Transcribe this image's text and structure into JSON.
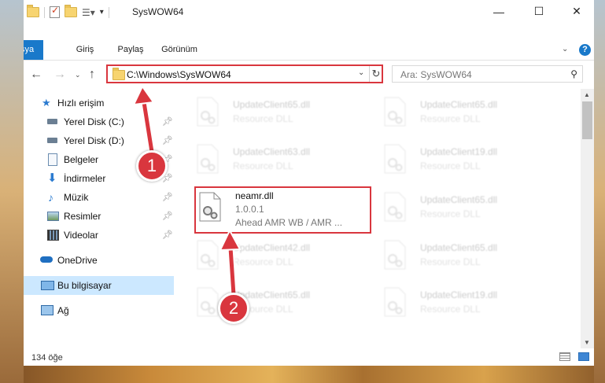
{
  "window": {
    "title": "SysWOW64",
    "minimize_glyph": "—",
    "maximize_glyph": "☐",
    "close_glyph": "✕"
  },
  "ribbon": {
    "tabs": [
      "Dosya",
      "Giriş",
      "Paylaş",
      "Görünüm"
    ],
    "help_glyph": "?"
  },
  "address": {
    "path": "C:\\Windows\\SysWOW64"
  },
  "search": {
    "placeholder": "Ara: SysWOW64"
  },
  "sidebar": {
    "items": [
      {
        "label": "Hızlı erişim",
        "icon": "star-icon",
        "pinned": false
      },
      {
        "label": "Yerel Disk (C:)",
        "icon": "drive-icon",
        "pinned": true
      },
      {
        "label": "Yerel Disk (D:)",
        "icon": "drive-icon",
        "pinned": true
      },
      {
        "label": "Belgeler",
        "icon": "documents-icon",
        "pinned": true
      },
      {
        "label": "İndirmeler",
        "icon": "download-icon",
        "pinned": true
      },
      {
        "label": "Müzik",
        "icon": "music-icon",
        "pinned": true
      },
      {
        "label": "Resimler",
        "icon": "pictures-icon",
        "pinned": true
      },
      {
        "label": "Videolar",
        "icon": "videos-icon",
        "pinned": true
      },
      {
        "label": "OneDrive",
        "icon": "cloud-icon",
        "pinned": false
      },
      {
        "label": "Bu bilgisayar",
        "icon": "computer-icon",
        "pinned": false,
        "selected": true
      },
      {
        "label": "Ağ",
        "icon": "network-icon",
        "pinned": false
      }
    ]
  },
  "files": [
    {
      "name": "UpdateClient65.dll",
      "desc": "Resource DLL"
    },
    {
      "name": "UpdateClient65.dll",
      "desc": "Resource DLL"
    },
    {
      "name": "UpdateClient63.dll",
      "desc": "Resource DLL"
    },
    {
      "name": "UpdateClient19.dll",
      "desc": "Resource DLL"
    },
    {
      "name": "neamr.dll",
      "desc": "1.0.0.1",
      "desc2": "Ahead AMR WB / AMR ..."
    },
    {
      "name": "UpdateClient65.dll",
      "desc": "Resource DLL"
    },
    {
      "name": "UpdateClient42.dll",
      "desc": "Resource DLL"
    },
    {
      "name": "UpdateClient65.dll",
      "desc": "Resource DLL"
    },
    {
      "name": "UpdateClient65.dll",
      "desc": "Resource DLL"
    },
    {
      "name": "UpdateClient19.dll",
      "desc": "Resource DLL"
    }
  ],
  "status": {
    "count_text": "134 öğe"
  },
  "callouts": [
    "1",
    "2"
  ],
  "colors": {
    "accent": "#1979ca",
    "highlight": "#d9363e",
    "selected": "#cce8ff"
  }
}
